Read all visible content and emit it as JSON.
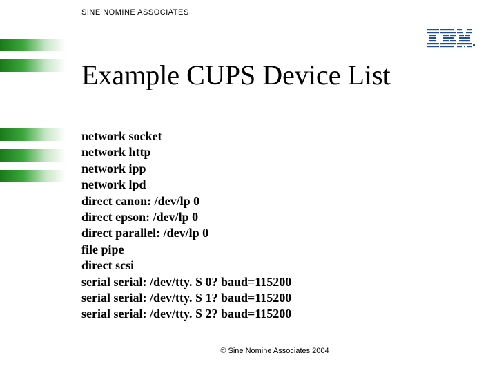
{
  "header": {
    "company": "SINE NOMINE ASSOCIATES"
  },
  "logo": {
    "name": "IBM"
  },
  "title": "Example CUPS Device List",
  "devices": [
    "network socket",
    "network http",
    "network ipp",
    "network lpd",
    "direct canon: /dev/lp 0",
    "direct epson: /dev/lp 0",
    "direct parallel: /dev/lp 0",
    "file pipe",
    "direct scsi",
    "serial serial: /dev/tty. S 0? baud=115200",
    "serial serial: /dev/tty. S 1? baud=115200",
    "serial serial: /dev/tty. S 2? baud=115200"
  ],
  "footer": {
    "copyright": "© Sine Nomine Associates 2004"
  }
}
